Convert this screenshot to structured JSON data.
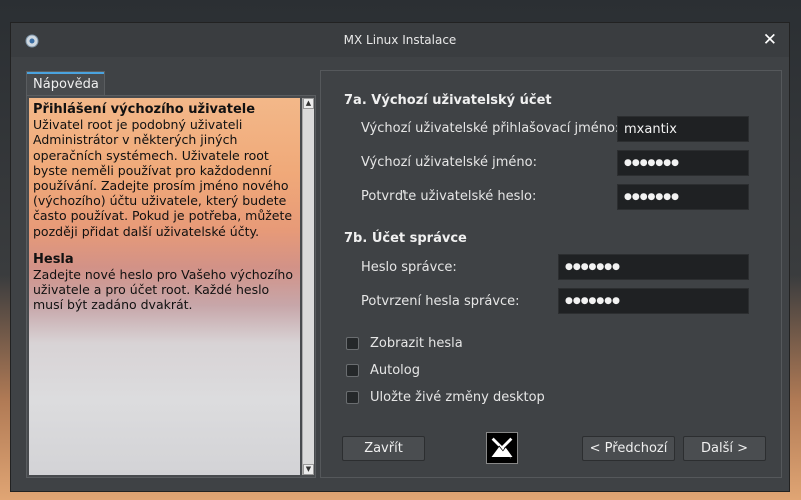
{
  "window": {
    "title": "MX Linux Instalace",
    "close_glyph": "✕"
  },
  "help": {
    "tab_label": "Nápověda",
    "sections": [
      {
        "heading": "Přihlášení výchozího uživatele",
        "body": "Uživatel root je podobný uživateli Administrátor v některých jiných operačních systémech. Uživatele root byste neměli používat pro každodenní používání. Zadejte prosím jméno nového (výchozího) účtu uživatele, který budete často používat. Pokud je potřeba, můžete později přidat další uživatelské účty."
      },
      {
        "heading": "Hesla",
        "body": "Zadejte nové heslo pro Vašeho výchozího uživatele a pro účet root. Každé heslo musí být zadáno dvakrát."
      }
    ]
  },
  "user_account": {
    "title": "7a. Výchozí uživatelský účet",
    "login_label": "Výchozí uživatelské přihlašovací jméno:",
    "login_value": "mxantix",
    "password_label": "Výchozí uživatelské jméno:",
    "password_value": "●●●●●●●",
    "confirm_label": "Potvrďte uživatelské heslo:",
    "confirm_value": "●●●●●●●"
  },
  "admin_account": {
    "title": "7b. Účet správce",
    "password_label": "Heslo správce:",
    "password_value": "●●●●●●●",
    "confirm_label": "Potvrzení hesla správce:",
    "confirm_value": "●●●●●●●"
  },
  "options": {
    "show_passwords": "Zobrazit hesla",
    "autologin": "Autolog",
    "save_live_changes": "Uložte živé změny desktop"
  },
  "buttons": {
    "close": "Zavřít",
    "previous": "< Předchozí",
    "next": "Další >"
  },
  "colors": {
    "accent": "#4aa3df",
    "field_bg": "#1f2123",
    "window_bg": "#3f4245"
  }
}
